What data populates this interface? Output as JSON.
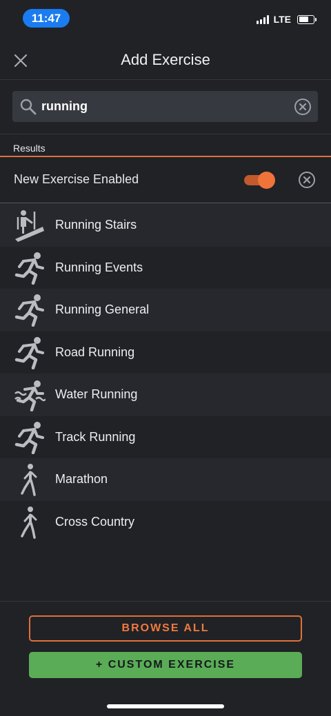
{
  "status_bar": {
    "time": "11:47",
    "network": "LTE",
    "battery_level": 0.7,
    "signal_bars": 4
  },
  "header": {
    "title": "Add Exercise",
    "close_icon": "close-icon"
  },
  "search": {
    "value": "running",
    "icon": "search-icon",
    "clear_icon": "clear-circle-icon"
  },
  "results": {
    "label": "Results",
    "new_exercise": {
      "label": "New Exercise Enabled",
      "enabled": true,
      "dismiss_icon": "clear-circle-icon"
    },
    "items": [
      {
        "label": "Running Stairs",
        "icon": "stair-climber-icon"
      },
      {
        "label": "Running Events",
        "icon": "runner-icon"
      },
      {
        "label": "Running General",
        "icon": "runner-icon"
      },
      {
        "label": "Road Running",
        "icon": "runner-icon"
      },
      {
        "label": "Water Running",
        "icon": "water-runner-icon"
      },
      {
        "label": "Track Running",
        "icon": "runner-icon"
      },
      {
        "label": "Marathon",
        "icon": "walker-icon"
      },
      {
        "label": "Cross Country",
        "icon": "walker-icon"
      }
    ]
  },
  "footer": {
    "browse_label": "BROWSE ALL",
    "custom_label": "+ CUSTOM EXERCISE"
  },
  "colors": {
    "background": "#202226",
    "accent": "#f0733a",
    "primary_button": "#5aac57",
    "time_pill": "#1a7cf0"
  }
}
